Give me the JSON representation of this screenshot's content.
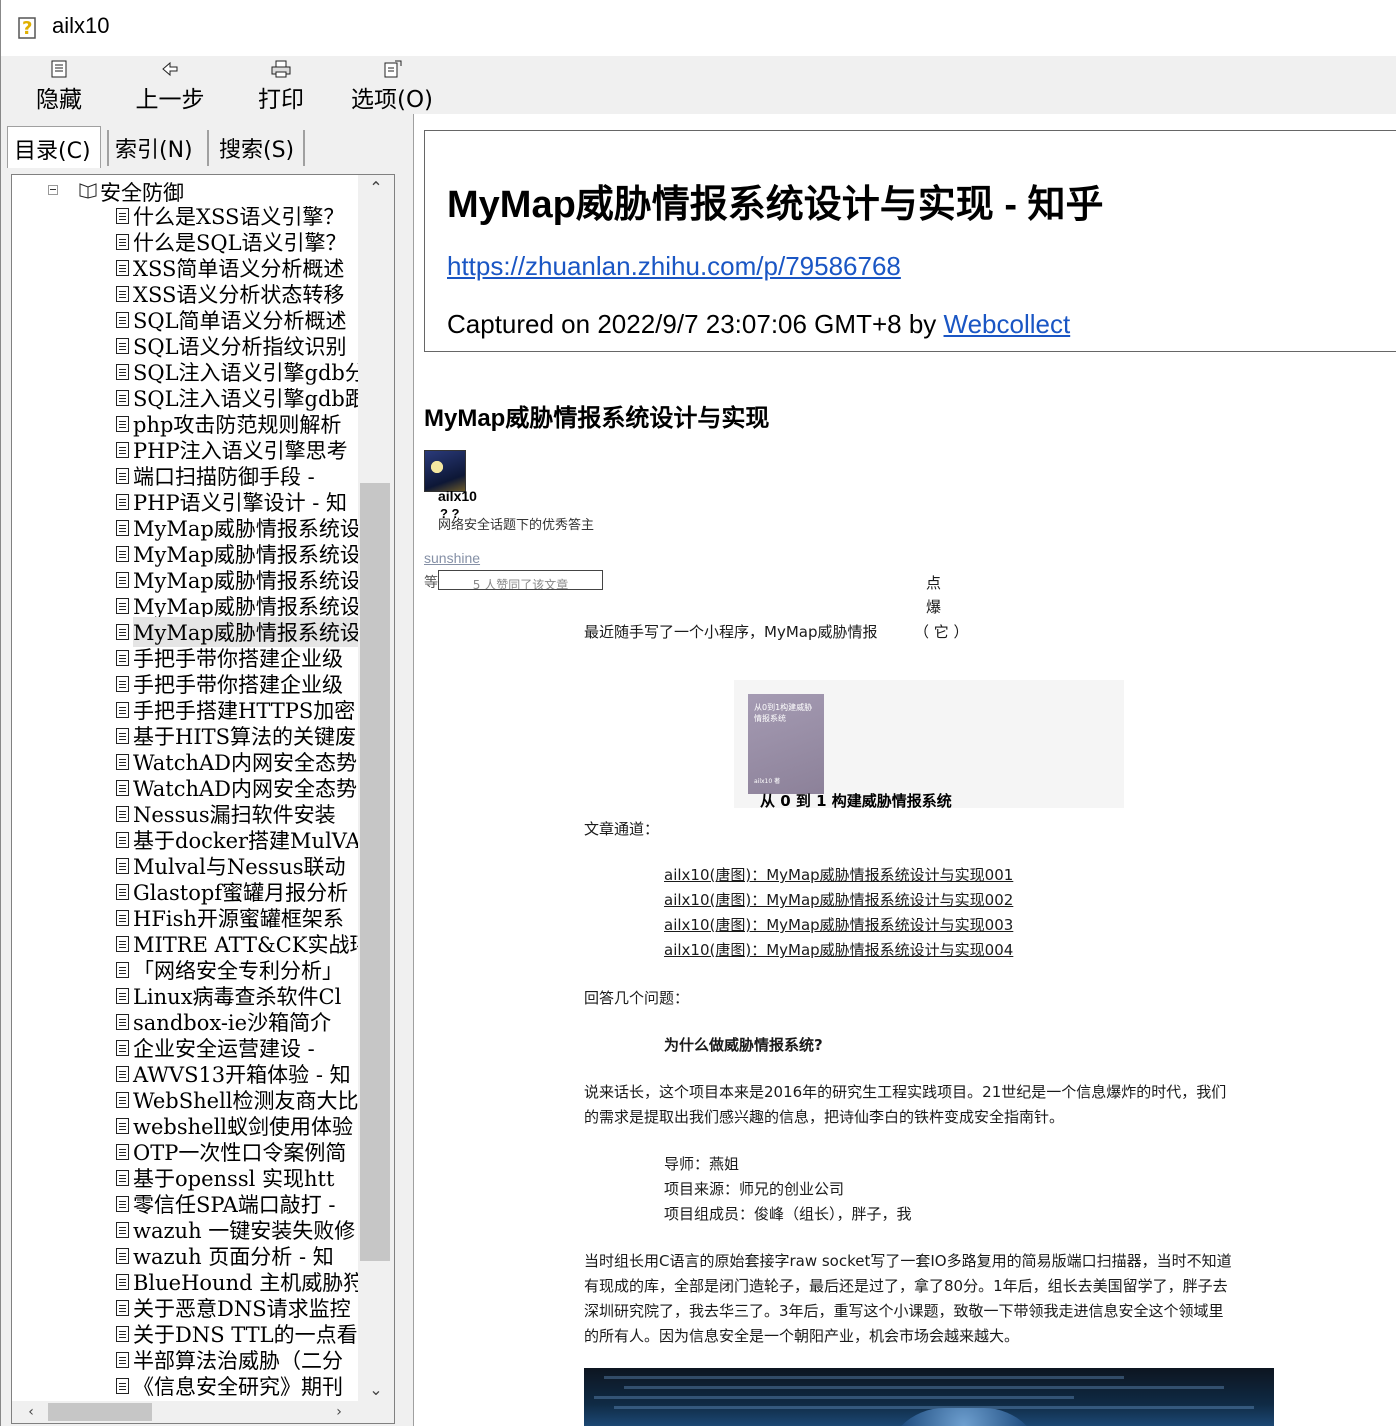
{
  "window": {
    "title": "ailx10"
  },
  "toolbar": {
    "hide": "隐藏",
    "back": "上一步",
    "print": "打印",
    "options": "选项(O)"
  },
  "tabs": [
    {
      "label": "目录(C)"
    },
    {
      "label": "索引(N)"
    },
    {
      "label": "搜索(S)"
    }
  ],
  "tree": {
    "root": "安全防御",
    "items": [
      "什么是XSS语义引擎？",
      "什么是SQL语义引擎？",
      "XSS简单语义分析概述",
      "XSS语义分析状态转移",
      "SQL简单语义分析概述",
      "SQL语义分析指纹识别",
      "SQL注入语义引擎gdb分",
      "SQL注入语义引擎gdb跟",
      "php攻击防范规则解析",
      "PHP注入语义引擎思考",
      "端口扫描防御手段 -",
      "PHP语义引擎设计 - 知",
      "MyMap威胁情报系统设",
      "MyMap威胁情报系统设",
      "MyMap威胁情报系统设",
      "MyMap威胁情报系统设",
      "MyMap威胁情报系统设",
      "手把手带你搭建企业级",
      "手把手带你搭建企业级",
      "手把手搭建HTTPS加密",
      "基于HITS算法的关键废",
      "WatchAD内网安全态势",
      "WatchAD内网安全态势",
      "Nessus漏扫软件安装",
      "基于docker搭建MulVA",
      "Mulval与Nessus联动",
      "Glastopf蜜罐月报分析",
      "HFish开源蜜罐框架系",
      "MITRE ATT&CK实战环境",
      "「网络安全专利分析」",
      "Linux病毒查杀软件Cl",
      "sandbox-ie沙箱简介",
      "企业安全运营建设 -",
      "AWVS13开箱体验 - 知",
      "WebShell检测友商大比",
      "webshell蚁剑使用体验",
      "OTP一次性口令案例简",
      "基于openssl 实现htt",
      "零信任SPA端口敲打 -",
      "wazuh 一键安装失败修",
      "wazuh 页面分析 - 知",
      "BlueHound 主机威胁狩",
      "关于恶意DNS请求监控",
      "关于DNS TTL的一点看",
      "半部算法治威胁（二分",
      "《信息安全研究》期刊"
    ],
    "selected_index": 16
  },
  "page": {
    "heading": "MyMap威胁情报系统设计与实现 - 知乎",
    "url": "https://zhuanlan.zhihu.com/p/79586768",
    "captured_prefix": "Captured on 2022/9/7 23:07:06 GMT+8 by ",
    "captured_by": "Webcollect",
    "article_title": "MyMap威胁情报系统设计与实现",
    "author": "ailx10",
    "author_qs": "? ?",
    "author_desc": "网络安全话题下的优秀答主",
    "tag": "sunshine",
    "deng": "等",
    "vote_text": "5 人赞同了该文章",
    "side_chars": [
      "点",
      "爆",
      "（ 它 ）"
    ],
    "intro": "最近随手写了一个小程序，MyMap威胁情报",
    "book_cover_lines": [
      "从0到1构建威胁",
      "情报系统"
    ],
    "book_cover_small": "ailx10 著",
    "book_caption": "从 0 到 1 构建威胁情报系统",
    "channel_label": "文章通道：",
    "links": [
      "ailx10(唐图)：MyMap威胁情报系统设计与实现001",
      "ailx10(唐图)：MyMap威胁情报系统设计与实现002",
      "ailx10(唐图)：MyMap威胁情报系统设计与实现003",
      "ailx10(唐图)：MyMap威胁情报系统设计与实现004"
    ],
    "qa_label": "回答几个问题：",
    "q1": "为什么做威胁情报系统?",
    "p1_line1": "说来话长，这个项目本来是2016年的研究生工程实践项目。21世纪是一个信息爆炸的时代，我们",
    "p1_line2": "的需求是提取出我们感兴趣的信息，把诗仙李白的铁杵变成安全指南针。",
    "mentor": "导师：燕姐",
    "source": "项目来源：师兄的创业公司",
    "members": "项目组成员：俊峰（组长），胖子，我",
    "p2_line1": "当时组长用C语言的原始套接字raw socket写了一套IO多路复用的简易版端口扫描器，当时不知道",
    "p2_line2": "有现成的库，全部是闭门造轮子，最后还是过了，拿了80分。1年后，组长去美国留学了，胖子去",
    "p2_line3": "深圳研究院了，我去华三了。3年后，重写这个小课题，致敬一下带领我走进信息安全这个领域里",
    "p2_line4": "的所有人。因为信息安全是一个朝阳产业，机会市场会越来越大。"
  }
}
